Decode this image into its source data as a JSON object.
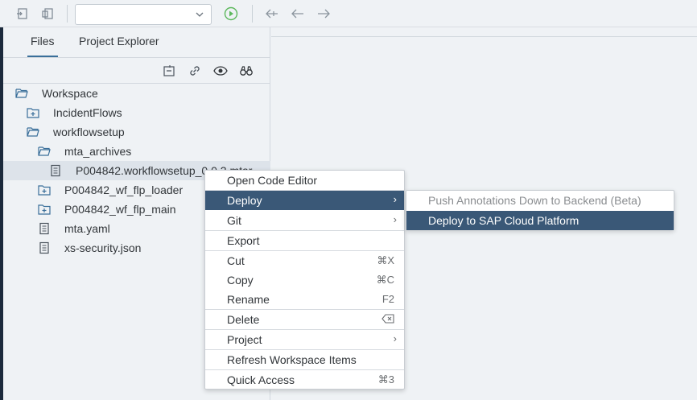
{
  "toolbar": {
    "dropdown_value": "",
    "icons": [
      "collapse-icon",
      "expand-icon",
      "run-icon",
      "first-icon",
      "back-icon",
      "forward-icon"
    ]
  },
  "panel": {
    "tabs": [
      {
        "label": "Files"
      },
      {
        "label": "Project Explorer"
      }
    ],
    "tools": [
      "collapse-all-icon",
      "link-icon",
      "eye-icon",
      "binoculars-icon"
    ]
  },
  "tree": [
    {
      "label": "Workspace",
      "icon": "folder-open-icon"
    },
    {
      "label": "IncidentFlows",
      "icon": "project-folder-icon"
    },
    {
      "label": "workflowsetup",
      "icon": "folder-open-icon"
    },
    {
      "label": "mta_archives",
      "icon": "folder-open-icon"
    },
    {
      "label": "P004842.workflowsetup_0.0.2.mtar",
      "icon": "file-icon"
    },
    {
      "label": "P004842_wf_flp_loader",
      "icon": "project-folder-icon"
    },
    {
      "label": "P004842_wf_flp_main",
      "icon": "project-folder-icon"
    },
    {
      "label": "mta.yaml",
      "icon": "file-icon"
    },
    {
      "label": "xs-security.json",
      "icon": "file-icon"
    }
  ],
  "context_menu": {
    "items": [
      {
        "label": "Open Code Editor",
        "shortcut": ""
      },
      {
        "label": "Deploy",
        "shortcut": ""
      },
      {
        "label": "Git",
        "shortcut": ""
      },
      {
        "label": "Export",
        "shortcut": ""
      },
      {
        "label": "Cut",
        "shortcut": "⌘X"
      },
      {
        "label": "Copy",
        "shortcut": "⌘C"
      },
      {
        "label": "Rename",
        "shortcut": "F2"
      },
      {
        "label": "Delete",
        "shortcut": ""
      },
      {
        "label": "Project",
        "shortcut": ""
      },
      {
        "label": "Refresh Workspace Items",
        "shortcut": ""
      },
      {
        "label": "Quick Access",
        "shortcut": "⌘3"
      }
    ],
    "submenu_arrow": "›"
  },
  "deploy_submenu": {
    "items": [
      {
        "label": "Push Annotations Down to Backend (Beta)"
      },
      {
        "label": "Deploy to SAP Cloud Platform"
      }
    ]
  },
  "colors": {
    "highlight": "#3a5877",
    "accent": "#3a6f9a",
    "run_green": "#5cb85c"
  }
}
